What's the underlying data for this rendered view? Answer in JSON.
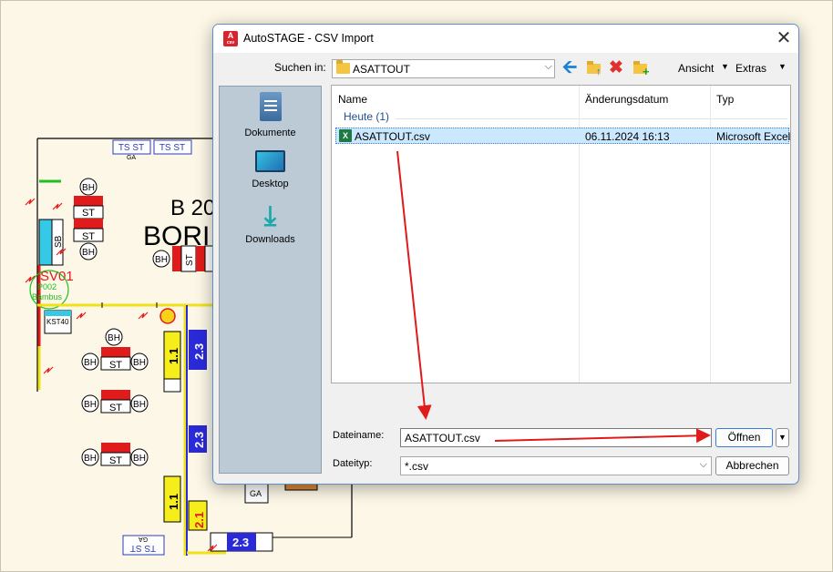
{
  "drawing": {
    "building_label": "B 20",
    "building_label_2": "BORI",
    "ts_st": "TS ST",
    "ga": "GA",
    "bh": "BH",
    "st": "ST",
    "sb": "SB",
    "sv01": "SV01",
    "p02": "P002",
    "bambus": "Bambus",
    "kst40": "KST40",
    "v11": "1.1",
    "v23": "2.3",
    "v21": "2.1"
  },
  "dialog": {
    "title": "AutoSTAGE - CSV Import",
    "app_icon": "A",
    "app_icon_sub": "csv",
    "close_icon": "✕",
    "toolbar": {
      "look_in_label": "Suchen in:",
      "look_in_value": "ASATTOUT",
      "view_label": "Ansicht",
      "extras_label": "Extras"
    },
    "places": [
      {
        "label": "Dokumente",
        "icon": "documents-icon"
      },
      {
        "label": "Desktop",
        "icon": "desktop-icon"
      },
      {
        "label": "Downloads",
        "icon": "downloads-icon"
      }
    ],
    "columns": [
      "Name",
      "Änderungsdatum",
      "Typ"
    ],
    "group_header": "Heute (1)",
    "files": [
      {
        "name": "ASATTOUT.csv",
        "modified": "06.11.2024 16:13",
        "type": "Microsoft Excel",
        "icon": "excel-icon"
      }
    ],
    "filename_label": "Dateiname:",
    "filename_value": "ASATTOUT.csv",
    "filetype_label": "Dateityp:",
    "filetype_value": "*.csv",
    "open_button": "Öffnen",
    "cancel_button": "Abbrechen"
  },
  "colors": {
    "annotation_arrow": "#e01b1b",
    "selection": "#cce8ff",
    "places_bar": "#bccad6",
    "drawing_background": "#fcf7e6"
  }
}
